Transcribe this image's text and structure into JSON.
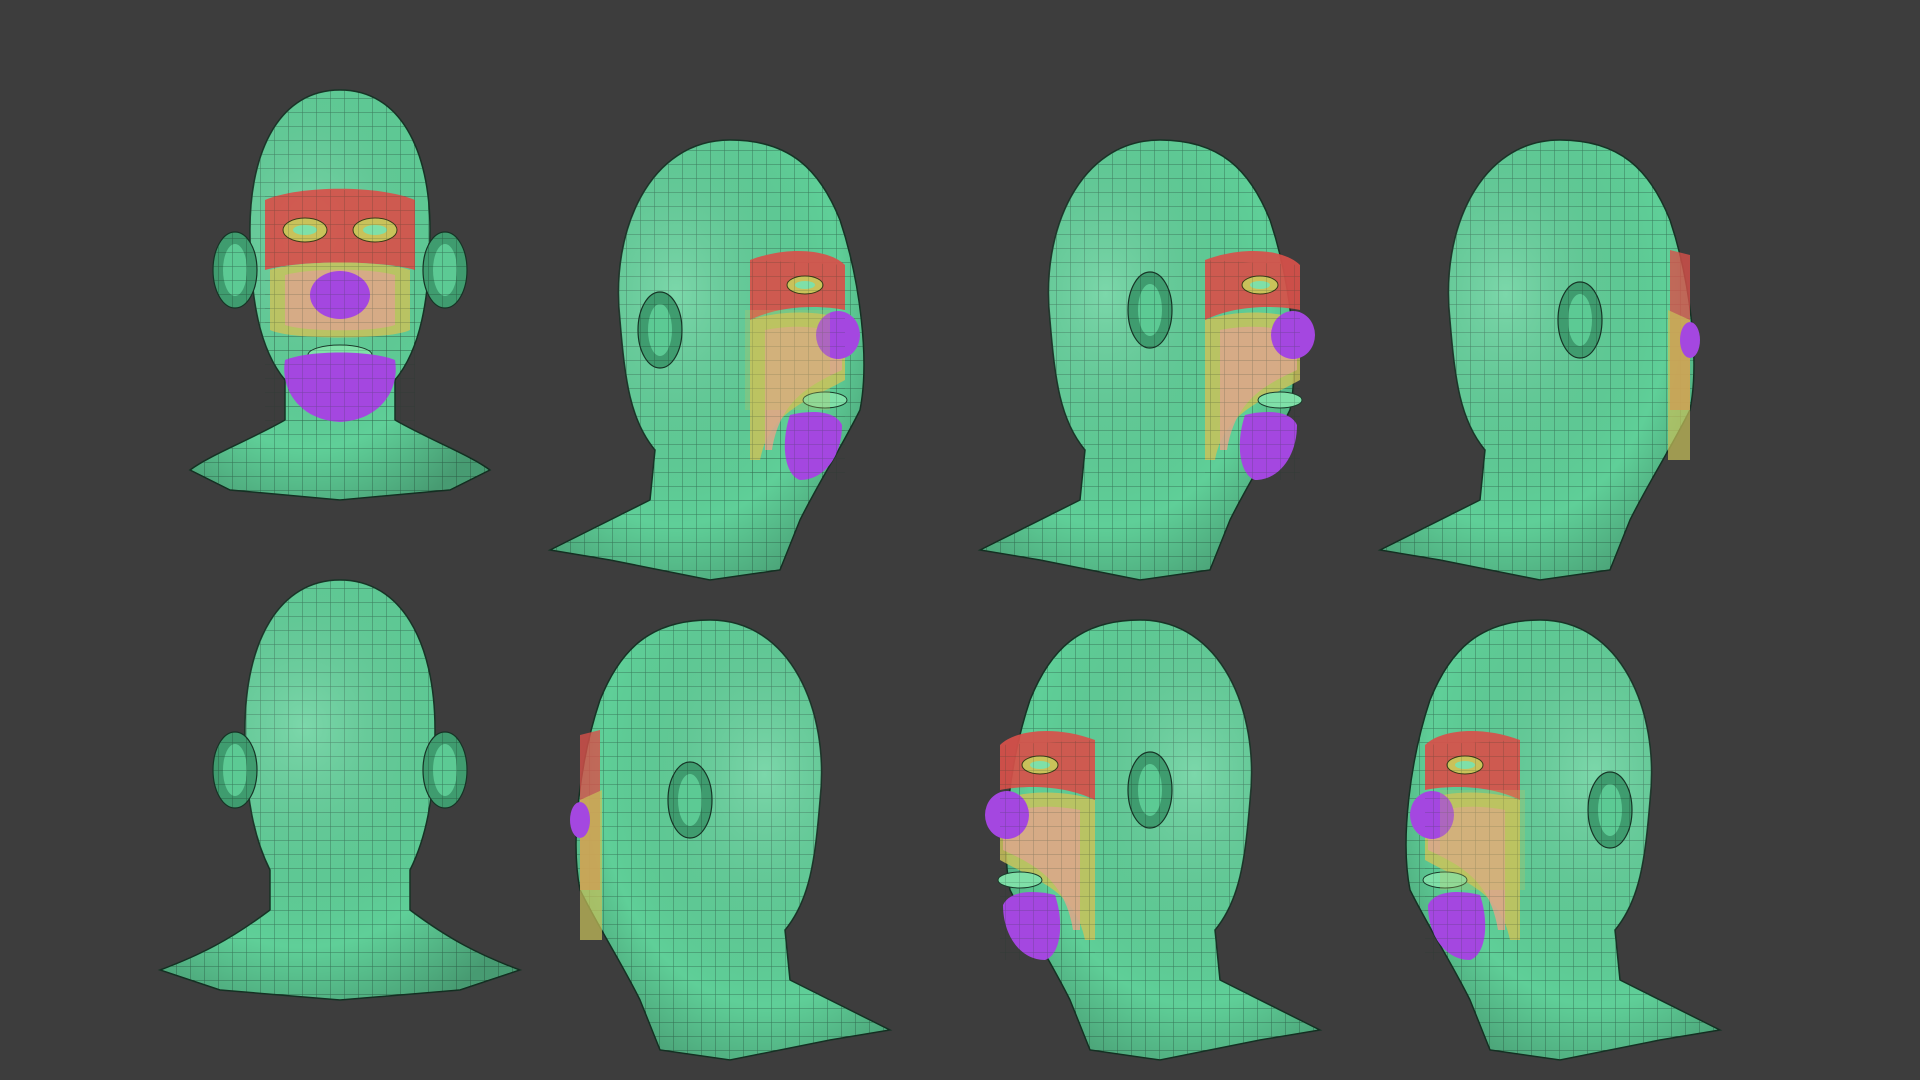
{
  "background": "#3d3d3d",
  "colors": {
    "skin": "#5fcf98",
    "skin_dark": "#3f9c6f",
    "wire": "#1b3b2b",
    "red": "#d8504a",
    "yellow": "#c9c25a",
    "mint": "#7fe0a8",
    "purple": "#a447e0",
    "peach": "#d9a88a"
  },
  "heads": [
    {
      "view": "front"
    },
    {
      "view": "three-quarter-right"
    },
    {
      "view": "profile-right"
    },
    {
      "view": "back-three-quarter-right"
    },
    {
      "view": "back"
    },
    {
      "view": "back-three-quarter-left"
    },
    {
      "view": "profile-left"
    },
    {
      "view": "three-quarter-left"
    }
  ]
}
